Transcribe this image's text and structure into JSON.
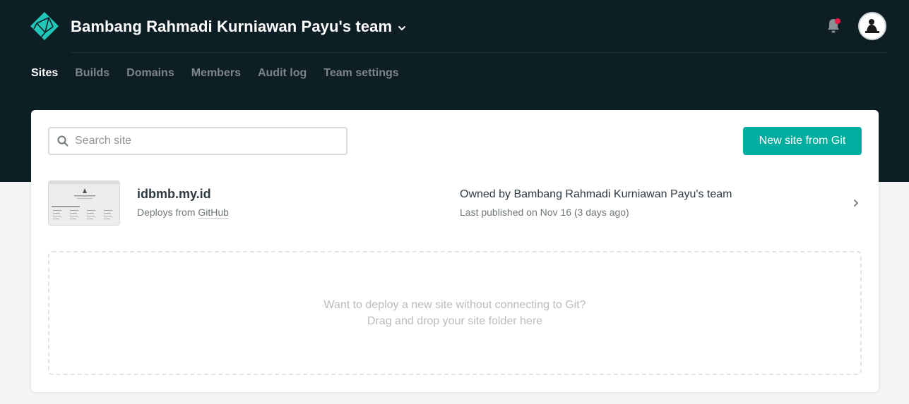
{
  "header": {
    "team_name": "Bambang Rahmadi Kurniawan Payu's team",
    "notification_badge": true
  },
  "nav": {
    "tabs": [
      {
        "label": "Sites",
        "active": true
      },
      {
        "label": "Builds",
        "active": false
      },
      {
        "label": "Domains",
        "active": false
      },
      {
        "label": "Members",
        "active": false
      },
      {
        "label": "Audit log",
        "active": false
      },
      {
        "label": "Team settings",
        "active": false
      }
    ]
  },
  "search": {
    "placeholder": "Search site",
    "value": ""
  },
  "actions": {
    "new_site_label": "New site from Git"
  },
  "sites": [
    {
      "name": "idbmb.my.id",
      "deploy_prefix": "Deploys from",
      "deploy_source": "GitHub",
      "owner": "Owned by Bambang Rahmadi Kurniawan Payu's team",
      "published": "Last published on Nov 16 (3 days ago)"
    }
  ],
  "dropzone": {
    "line1": "Want to deploy a new site without connecting to Git?",
    "line2": "Drag and drop your site folder here"
  },
  "colors": {
    "header_bg": "#0e1e25",
    "accent": "#00ad9f",
    "badge": "#e8174b",
    "logo": "#20c6b7"
  },
  "icons": {
    "logo": "netlify-logo-icon",
    "team_switch": "chevron-down-icon",
    "notifications": "bell-icon",
    "search": "search-icon",
    "row_open": "chevron-right-icon"
  }
}
